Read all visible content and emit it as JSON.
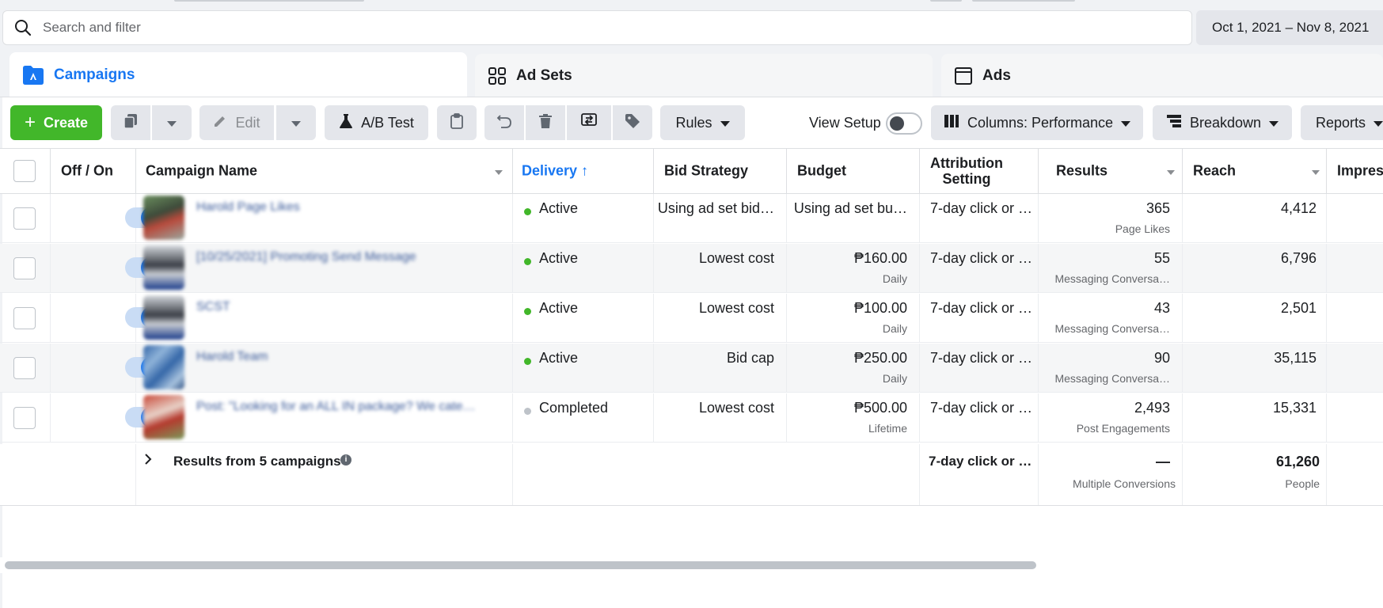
{
  "search": {
    "placeholder": "Search and filter"
  },
  "date_range": "Oct 1, 2021 – Nov 8, 2021",
  "tabs": [
    {
      "label": "Campaigns",
      "icon": "campaign-folder-icon",
      "active": true
    },
    {
      "label": "Ad Sets",
      "icon": "grid-icon",
      "active": false
    },
    {
      "label": "Ads",
      "icon": "ad-window-icon",
      "active": false
    }
  ],
  "toolbar": {
    "create_label": "Create",
    "edit_label": "Edit",
    "ab_test_label": "A/B Test",
    "rules_label": "Rules",
    "view_setup_label": "View Setup",
    "columns_label": "Columns: Performance",
    "breakdown_label": "Breakdown",
    "reports_label": "Reports"
  },
  "table": {
    "headers": {
      "off_on": "Off / On",
      "campaign_name": "Campaign Name",
      "delivery": "Delivery",
      "bid_strategy": "Bid Strategy",
      "budget": "Budget",
      "attribution_line1": "Attribution",
      "attribution_line2": "Setting",
      "results": "Results",
      "reach": "Reach",
      "impressions": "Impress"
    },
    "rows": [
      {
        "name": "Harold Page Likes",
        "delivery": "Active",
        "delivery_color": "#42b72a",
        "bid_strategy": "Using ad set bid…",
        "budget": "Using ad set bu…",
        "budget_sub": "",
        "attribution": "7-day click or …",
        "results": "365",
        "results_sub": "Page Likes",
        "reach": "4,412"
      },
      {
        "name": "[10/25/2021] Promoting Send Message",
        "delivery": "Active",
        "delivery_color": "#42b72a",
        "bid_strategy": "Lowest cost",
        "budget": "₱160.00",
        "budget_sub": "Daily",
        "attribution": "7-day click or …",
        "results": "55",
        "results_sub": "Messaging Conversa…",
        "reach": "6,796"
      },
      {
        "name": "SCST",
        "delivery": "Active",
        "delivery_color": "#42b72a",
        "bid_strategy": "Lowest cost",
        "budget": "₱100.00",
        "budget_sub": "Daily",
        "attribution": "7-day click or …",
        "results": "43",
        "results_sub": "Messaging Conversa…",
        "reach": "2,501"
      },
      {
        "name": "Harold Team",
        "delivery": "Active",
        "delivery_color": "#42b72a",
        "bid_strategy": "Bid cap",
        "budget": "₱250.00",
        "budget_sub": "Daily",
        "attribution": "7-day click or …",
        "results": "90",
        "results_sub": "Messaging Conversa…",
        "reach": "35,115"
      },
      {
        "name": "Post: \"Looking for an ALL IN package? We cate…",
        "delivery": "Completed",
        "delivery_color": "#bec3c9",
        "bid_strategy": "Lowest cost",
        "budget": "₱500.00",
        "budget_sub": "Lifetime",
        "attribution": "7-day click or …",
        "results": "2,493",
        "results_sub": "Post Engagements",
        "reach": "15,331"
      }
    ],
    "footer": {
      "label": "Results from 5 campaigns",
      "attribution": "7-day click or …",
      "results": "—",
      "results_sub": "Multiple Conversions",
      "reach": "61,260",
      "reach_sub": "People"
    }
  },
  "colors": {
    "accent": "#1877f2",
    "create": "#42b72a",
    "active_dot": "#42b72a",
    "completed_dot": "#bec3c9"
  }
}
